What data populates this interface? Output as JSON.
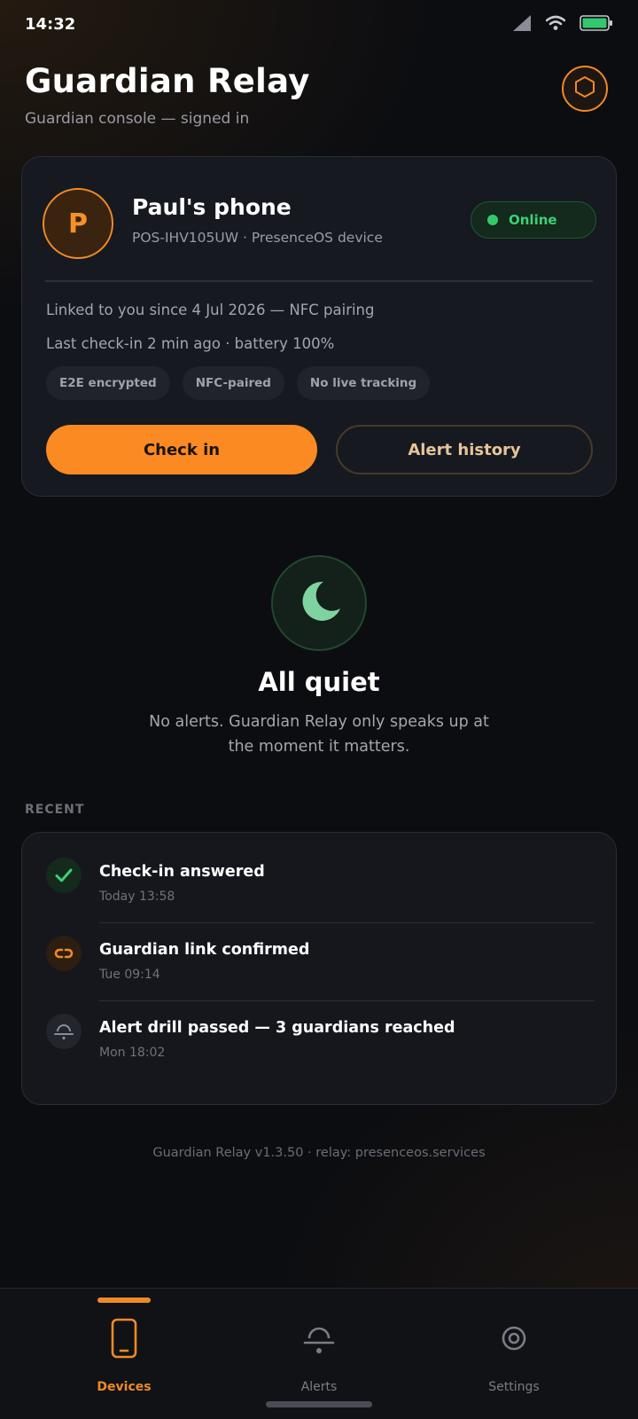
{
  "status_bar": {
    "time": "14:32",
    "icons": [
      "signal-icon",
      "wifi-icon",
      "battery-icon"
    ]
  },
  "header": {
    "title": "Guardian Relay",
    "subtitle": "Guardian console — signed in",
    "action_icon": "shield-icon"
  },
  "device": {
    "avatar_initial": "P",
    "name": "Paul's phone",
    "identifier": "POS-IHV105UW · PresenceOS device",
    "status": "Online",
    "linked_info": "Linked to you since 4 Jul 2026 — NFC pairing",
    "checkin_info": "Last check-in 2 min ago · battery 100%",
    "chips": [
      "E2E encrypted",
      "NFC-paired",
      "No live tracking"
    ],
    "primary_action": "Check in",
    "secondary_action": "Alert history"
  },
  "quiet_state": {
    "icon": "moon-icon",
    "title": "All quiet",
    "description": "No alerts. Guardian Relay only speaks up at the moment it matters."
  },
  "recent": {
    "label": "RECENT",
    "items": [
      {
        "title": "Check-in answered",
        "time": "Today 13:58",
        "icon": "check-icon"
      },
      {
        "title": "Guardian link confirmed",
        "time": "Tue 09:14",
        "icon": "link-icon"
      },
      {
        "title": "Alert drill passed — 3 guardians reached",
        "time": "Mon 18:02",
        "icon": "bell-icon"
      }
    ]
  },
  "footer": {
    "version_text": "Guardian Relay v1.3.50 · relay: presenceos.services"
  },
  "bottom_nav": {
    "items": [
      {
        "label": "Devices",
        "icon": "phone-icon",
        "active": true
      },
      {
        "label": "Alerts",
        "icon": "bell-icon",
        "active": false
      },
      {
        "label": "Settings",
        "icon": "settings-icon",
        "active": false
      }
    ]
  },
  "colors": {
    "accent": "#f08a24",
    "primary_button": "#fb8a22",
    "online": "#34c86c",
    "background": "#0c0d11",
    "card": "#161920"
  }
}
